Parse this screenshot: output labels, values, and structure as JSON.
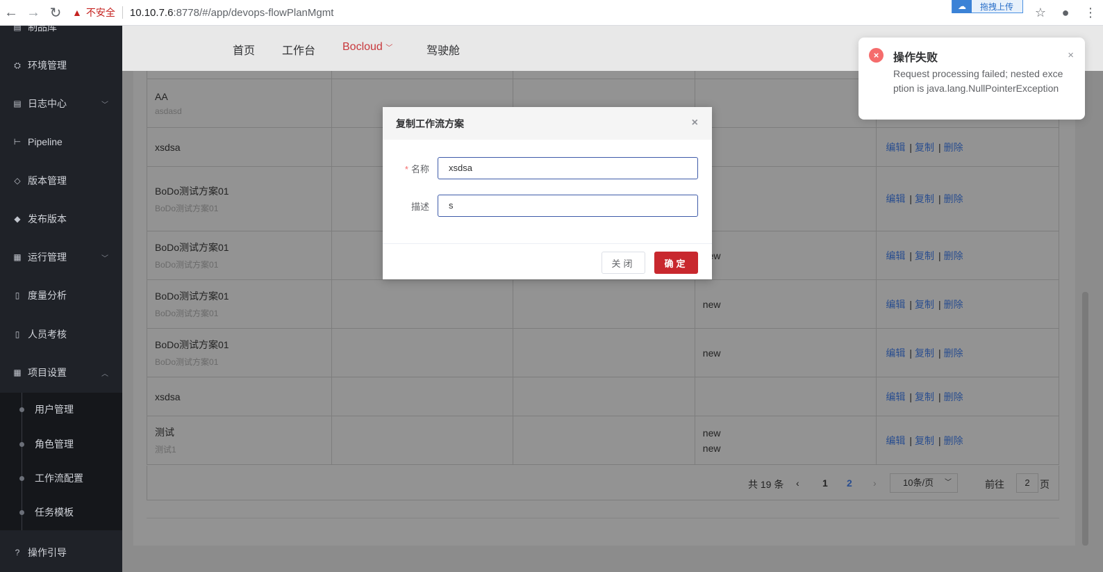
{
  "browser": {
    "back": "←",
    "forward": "→",
    "reload": "↻",
    "insecure_label": "不安全",
    "url_host": "10.10.7.6",
    "url_rest": ":8778/#/app/devops-flowPlanMgmt",
    "extension_label": "拖拽上传",
    "star": "☆",
    "account": "●",
    "menu": "⋮"
  },
  "sidebar": {
    "items": [
      {
        "label": "制品库",
        "icon": "file-icon"
      },
      {
        "label": "环境管理",
        "icon": "env-icon"
      },
      {
        "label": "日志中心",
        "icon": "log-icon",
        "chevron": "﹀"
      },
      {
        "label": "Pipeline",
        "icon": "pipeline-icon"
      },
      {
        "label": "版本管理",
        "icon": "box-icon"
      },
      {
        "label": "发布版本",
        "icon": "release-icon"
      },
      {
        "label": "运行管理",
        "icon": "grid-icon",
        "chevron": "﹀"
      },
      {
        "label": "度量分析",
        "icon": "doc-icon"
      },
      {
        "label": "人员考核",
        "icon": "doc-icon"
      },
      {
        "label": "项目设置",
        "icon": "grid-icon",
        "chevron": "︿"
      }
    ],
    "sub_items": [
      "用户管理",
      "角色管理",
      "工作流配置",
      "任务模板"
    ],
    "footer": "操作引导"
  },
  "topnav": {
    "tabs": [
      "首页",
      "工作台",
      "Bocloud",
      "驾驶舱"
    ],
    "bocloud_chevron": "﹀"
  },
  "table": {
    "rows": [
      {
        "name": "AA",
        "desc": "asdasd",
        "col4": [],
        "ops": true
      },
      {
        "name": "xsdsa",
        "desc": "",
        "col4": [],
        "ops": true
      },
      {
        "name": "BoDo测试方案01",
        "desc": "BoDo测试方案01",
        "col4": [],
        "ops": true
      },
      {
        "name": "BoDo测试方案01",
        "desc": "BoDo测试方案01",
        "col4": [
          "new"
        ],
        "ops": true
      },
      {
        "name": "BoDo测试方案01",
        "desc": "BoDo测试方案01",
        "col4": [
          "new"
        ],
        "ops": true
      },
      {
        "name": "BoDo测试方案01",
        "desc": "BoDo测试方案01",
        "col4": [
          "new"
        ],
        "ops": true
      },
      {
        "name": "xsdsa",
        "desc": "",
        "col4": [],
        "ops": true
      },
      {
        "name": "测试",
        "desc": "测试1",
        "col4": [
          "new",
          "new"
        ],
        "ops": true
      }
    ],
    "op_edit": "编辑",
    "op_copy": "复制",
    "op_delete": "删除",
    "op_sep": "|"
  },
  "pagination": {
    "total": "共 19 条",
    "prev": "‹",
    "pages": [
      "1",
      "2"
    ],
    "next": "›",
    "page_size": "10条/页",
    "size_chevron": "﹀",
    "goto_label": "前往",
    "goto_value": "2",
    "page_suffix": "页"
  },
  "modal": {
    "title": "复制工作流方案",
    "close": "×",
    "name_label": "名称",
    "required_mark": "*",
    "name_value": "xsdsa",
    "desc_label": "描述",
    "desc_value": "s",
    "cancel": "关闭",
    "ok": "确定"
  },
  "notification": {
    "icon": "×",
    "title": "操作失败",
    "message": "Request processing failed; nested exception is java.lang.NullPointerException",
    "close": "×"
  },
  "colors": {
    "accent": "#c8282e",
    "link": "#2a4e8f",
    "error": "#f56c6c",
    "sidebar": "#1f2228"
  }
}
